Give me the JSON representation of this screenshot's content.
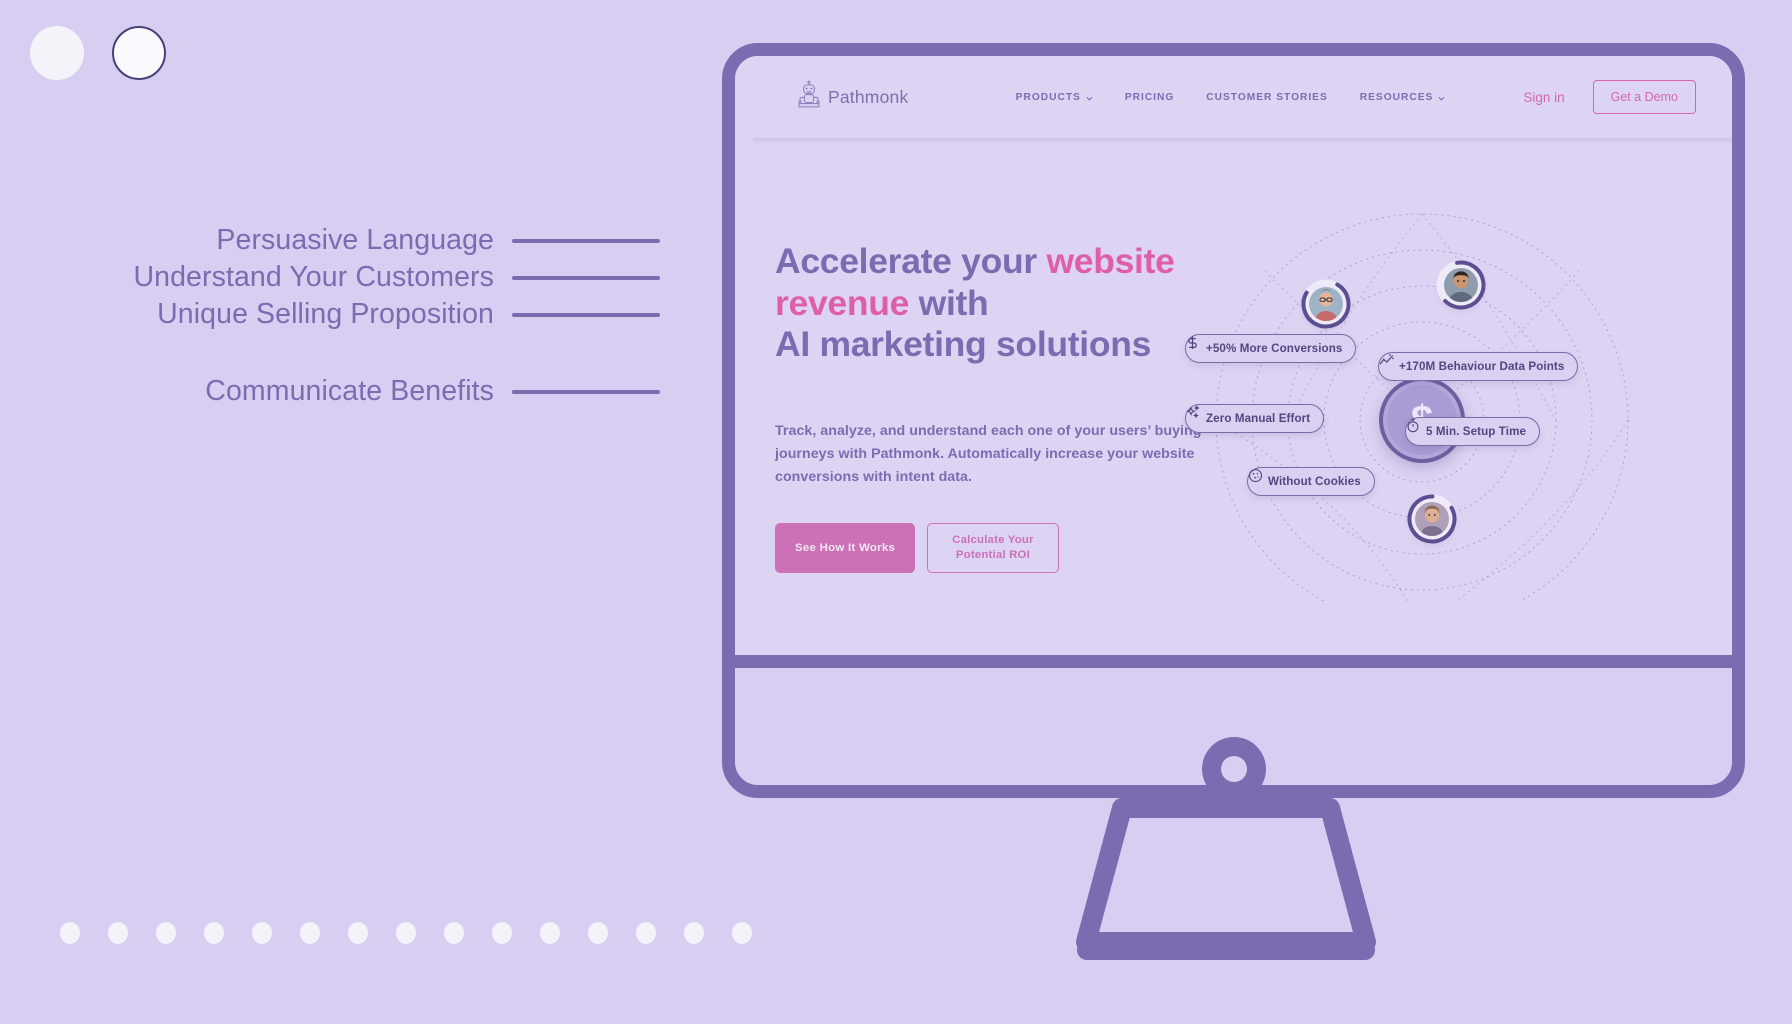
{
  "theme": {
    "page_bg": "#D8CEF2",
    "frame": "#7C6BB0",
    "screen_bg": "#DDD4F4",
    "accent_pink": "#D467AE",
    "accent_purple": "#7C6BB0",
    "badge_text": "#534680"
  },
  "left_panel": {
    "markers": [
      {
        "name": "circle-plain",
        "style": "filled"
      },
      {
        "name": "circle-outlined",
        "style": "outlined"
      }
    ],
    "bullets": [
      {
        "label": "Persuasive Language"
      },
      {
        "label": "Understand Your Customers"
      },
      {
        "label": "Unique Selling Proposition"
      },
      {
        "label": "Communicate Benefits"
      }
    ],
    "dot_count": 15
  },
  "site": {
    "brand": {
      "name": "Pathmonk",
      "logo_icon": "meditating-robot-icon"
    },
    "nav": [
      {
        "label": "PRODUCTS",
        "has_dropdown": true
      },
      {
        "label": "PRICING",
        "has_dropdown": false
      },
      {
        "label": "CUSTOMER STORIES",
        "has_dropdown": false
      },
      {
        "label": "RESOURCES",
        "has_dropdown": true
      }
    ],
    "sign_in": "Sign in",
    "demo_button": "Get a Demo",
    "hero": {
      "title_line1_a": "Accelerate your ",
      "title_line1_b": "website",
      "title_line2_a": "revenue",
      "title_line2_b": " with",
      "title_line3": "AI marketing solutions",
      "paragraph": "Track, analyze, and understand each one of your users’ buying journeys with Pathmonk. Automatically increase your website conversions with intent data.",
      "cta_primary": "See How It Works",
      "cta_secondary_line1": "Calculate Your",
      "cta_secondary_line2": "Potential ROI"
    },
    "orbit": {
      "core_glyph": "$",
      "core_icon": "dollar-coin-icon",
      "badges": [
        {
          "icon": "dollar-icon",
          "text": "+50% More Conversions"
        },
        {
          "icon": "line-chart-icon",
          "text": "+170M Behaviour Data Points"
        },
        {
          "icon": "sparkle-icon",
          "text": "Zero Manual Effort"
        },
        {
          "icon": "stopwatch-icon",
          "text": "5 Min. Setup Time"
        },
        {
          "icon": "cookie-icon",
          "text": "Without Cookies"
        }
      ],
      "avatars": [
        {
          "name": "avatar-user-1"
        },
        {
          "name": "avatar-user-2"
        },
        {
          "name": "avatar-user-3"
        }
      ]
    }
  }
}
